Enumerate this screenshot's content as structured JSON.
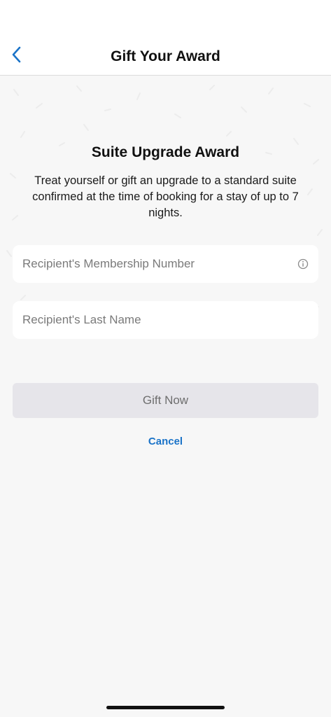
{
  "nav": {
    "title": "Gift Your Award",
    "back_icon": "chevron-left-icon",
    "accent_color": "#1a73c8"
  },
  "award": {
    "title": "Suite Upgrade Award",
    "description": "Treat yourself or gift an upgrade to a standard suite confirmed at the time of booking for a stay of up to 7 nights."
  },
  "form": {
    "membership_number": {
      "placeholder": "Recipient's Membership Number",
      "value": "",
      "icon": "info-icon"
    },
    "last_name": {
      "placeholder": "Recipient's Last Name",
      "value": ""
    }
  },
  "actions": {
    "gift_label": "Gift Now",
    "cancel_label": "Cancel"
  }
}
